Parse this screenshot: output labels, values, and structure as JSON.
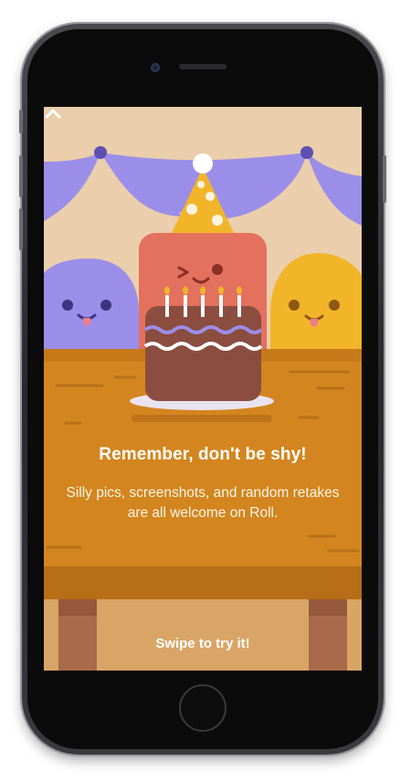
{
  "onboarding": {
    "title": "Remember, don't be shy!",
    "subtitle": "Silly pics, screenshots, and random retakes are all welcome on Roll.",
    "swipe_label": "Swipe to try it!"
  },
  "illustration": {
    "scene": "birthday-cake-party",
    "colors": {
      "background": "#ebceab",
      "bunting": "#9b8ee8",
      "table": "#d3851f",
      "left_blob": "#9b8ee8",
      "right_blob": "#f2b52a",
      "cake_character": "#e4705e",
      "cake": "#8b4d3f"
    }
  },
  "icons": {
    "swipe": "chevron-up-icon"
  }
}
